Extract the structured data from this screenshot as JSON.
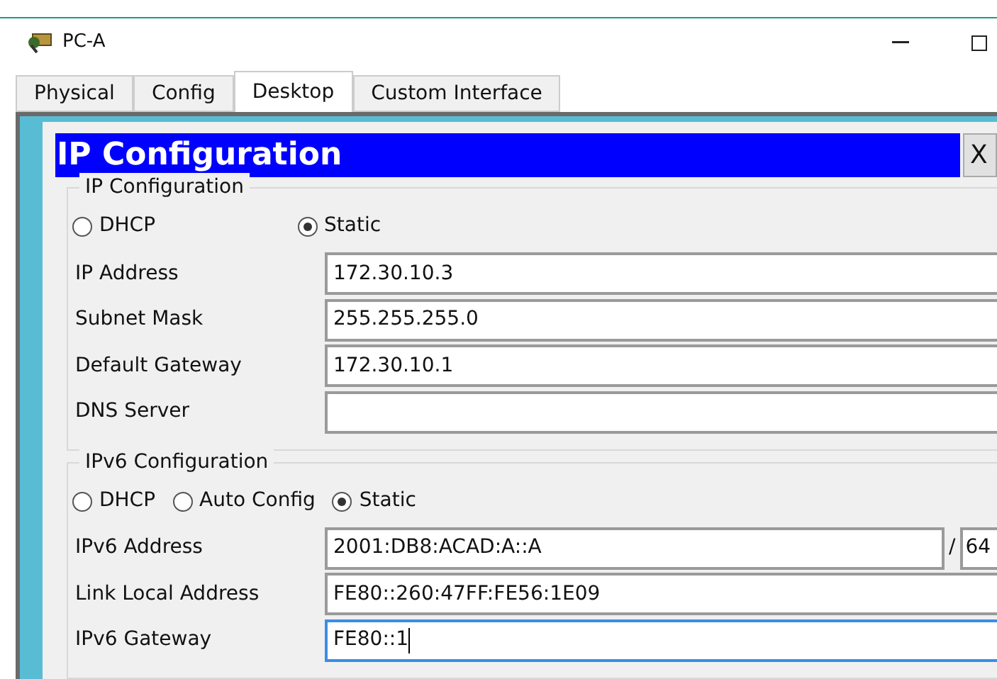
{
  "window": {
    "title": "PC-A"
  },
  "tabs": [
    {
      "label": "Physical",
      "selected": false
    },
    {
      "label": "Config",
      "selected": false
    },
    {
      "label": "Desktop",
      "selected": true
    },
    {
      "label": "Custom Interface",
      "selected": false
    }
  ],
  "dialog": {
    "title": "IP Configuration",
    "close": "X"
  },
  "ipv4": {
    "legend": "IP Configuration",
    "modes": [
      {
        "label": "DHCP",
        "selected": false
      },
      {
        "label": "Static",
        "selected": true
      }
    ],
    "fields": [
      {
        "label": "IP Address",
        "value": "172.30.10.3",
        "focused": false
      },
      {
        "label": "Subnet Mask",
        "value": "255.255.255.0",
        "focused": false
      },
      {
        "label": "Default Gateway",
        "value": "172.30.10.1",
        "focused": false
      },
      {
        "label": "DNS Server",
        "focused": false
      }
    ]
  },
  "ipv6": {
    "legend": "IPv6 Configuration",
    "modes": [
      {
        "label": "DHCP",
        "selected": false
      },
      {
        "label": "Auto Config",
        "selected": false
      },
      {
        "label": "Static",
        "selected": true
      }
    ],
    "fields": [
      {
        "label": "IPv6 Address",
        "value": "2001:DB8:ACAD:A::A",
        "focused": false,
        "separator": "/",
        "prefix": "64"
      },
      {
        "label": "Link Local Address",
        "value": "FE80::260:47FF:FE56:1E09",
        "focused": false
      },
      {
        "label": "IPv6 Gateway",
        "value": "FE80::1",
        "focused": true
      }
    ]
  }
}
